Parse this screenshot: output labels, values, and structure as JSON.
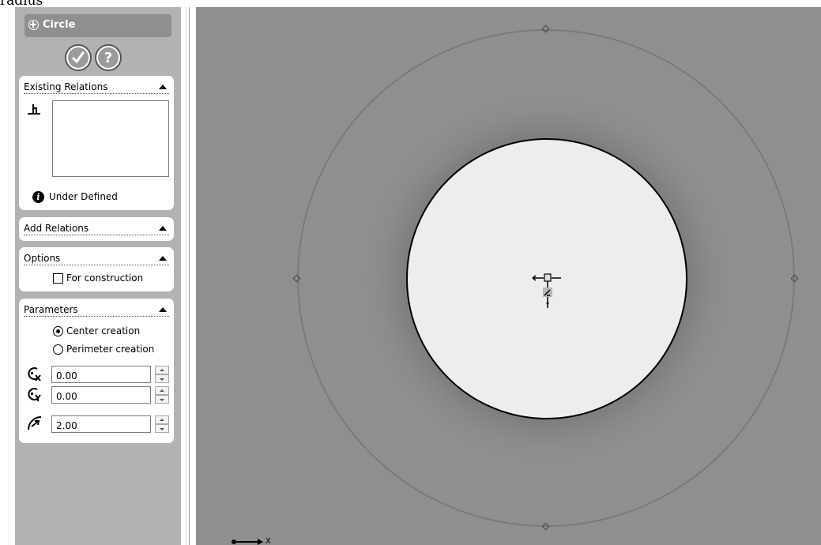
{
  "caption": "radius",
  "property_manager": {
    "title": "Circle",
    "ok_icon": "checkmark-icon",
    "help_icon": "question-mark-icon",
    "help_symbol": "?",
    "existing_relations": {
      "header": "Existing Relations",
      "status_text": "Under Defined",
      "info_symbol": "i"
    },
    "add_relations": {
      "header": "Add Relations"
    },
    "options": {
      "header": "Options",
      "for_construction_label": "For construction",
      "for_construction_checked": false
    },
    "parameters": {
      "header": "Parameters",
      "center_creation_label": "Center creation",
      "perimeter_creation_label": "Perimeter creation",
      "selected_mode": "Center creation",
      "center_x": "0.00",
      "center_y": "0.00",
      "radius": "2.00"
    }
  },
  "graphics": {
    "axis_label": "X",
    "background": "#8f8f8f"
  }
}
